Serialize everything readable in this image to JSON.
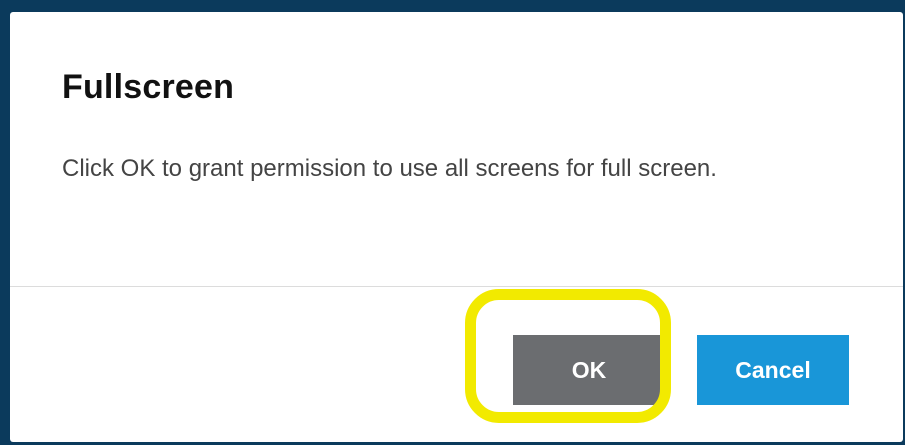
{
  "dialog": {
    "title": "Fullscreen",
    "message": "Click OK to grant permission to use all screens for full screen.",
    "ok_label": "OK",
    "cancel_label": "Cancel"
  },
  "colors": {
    "backdrop": "#0b3a5c",
    "ok_button": "#6b6d70",
    "cancel_button": "#1996d8",
    "highlight": "#f2ea00"
  }
}
